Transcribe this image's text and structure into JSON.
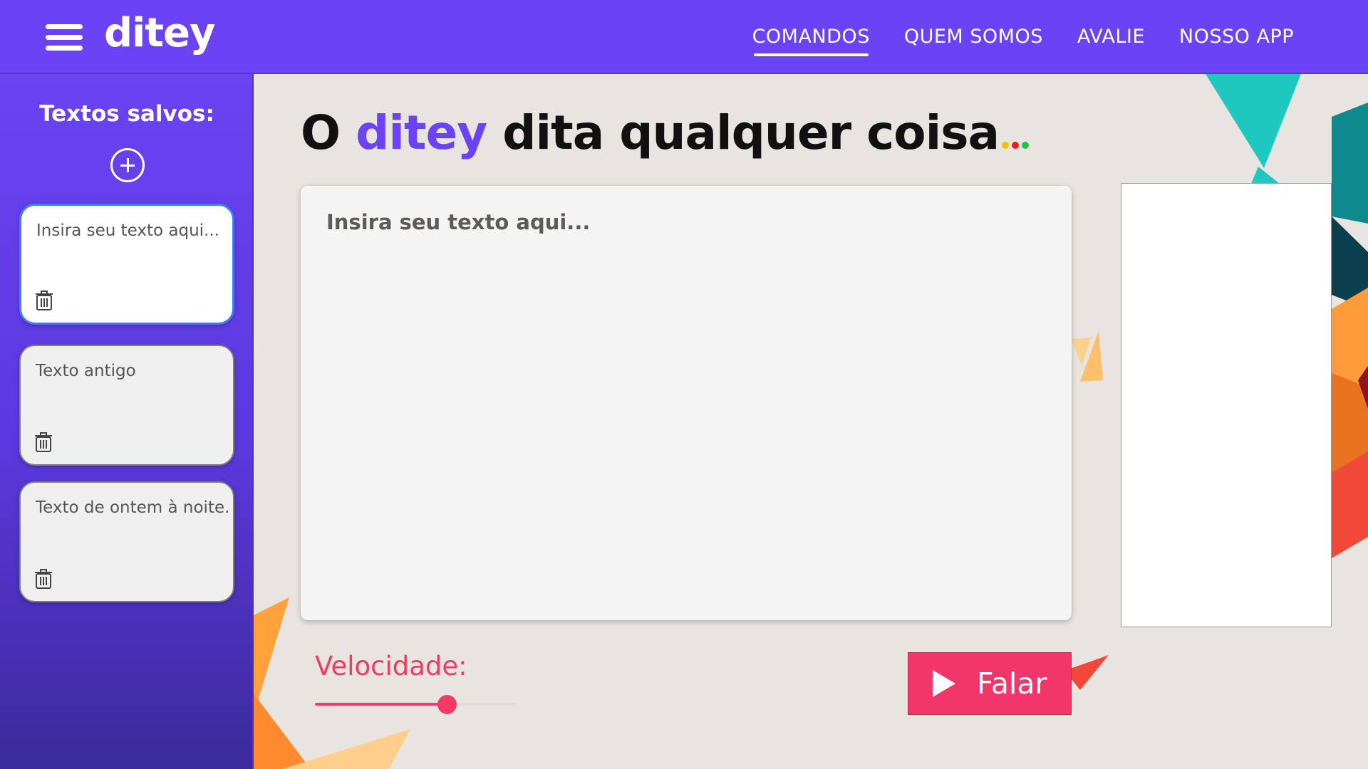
{
  "header": {
    "logo": "ditey",
    "nav": [
      {
        "label": "COMANDOS",
        "active": true
      },
      {
        "label": "QUEM SOMOS",
        "active": false
      },
      {
        "label": "AVALIE",
        "active": false
      },
      {
        "label": "NOSSO APP",
        "active": false
      }
    ]
  },
  "sidebar": {
    "title": "Textos salvos:",
    "add_icon": "plus-circle-icon",
    "items": [
      {
        "text": "Insira seu texto aqui...",
        "selected": true
      },
      {
        "text": "Texto antigo",
        "selected": false
      },
      {
        "text": "Texto de ontem à noite.",
        "selected": false
      }
    ]
  },
  "main": {
    "headline_prefix": "O",
    "headline_brand": "ditey",
    "headline_suffix": "dita qualquer coisa",
    "headline_dots_colors": [
      "#f2c200",
      "#f01e1e",
      "#1ec83c"
    ],
    "textarea_placeholder": "Insira seu texto aqui...",
    "speed_label": "Velocidade:",
    "speed_value": 0.65,
    "speak_button_label": "Falar"
  },
  "colors": {
    "brand_purple": "#6c43f4",
    "accent_pink": "#f2356a",
    "background": "#e8e4df"
  }
}
